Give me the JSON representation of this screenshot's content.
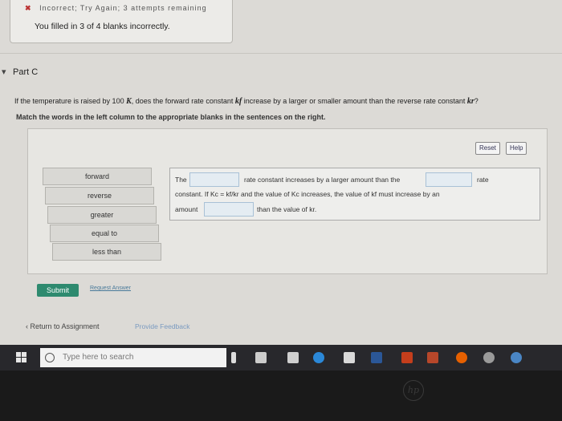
{
  "feedback": {
    "top_line": "Incorrect; Try Again; 3 attempts remaining",
    "message": "You filled in 3 of 4 blanks incorrectly."
  },
  "part": {
    "label": "Part C"
  },
  "question": {
    "prefix": "If the temperature is raised by 100",
    "unit": "K",
    "mid": ", does the forward rate constant",
    "kf": "kf",
    "suffix": "increase by a larger or smaller amount than the reverse rate constant",
    "kr": "kr",
    "qmark": "?"
  },
  "instruction": "Match the words in the left column to the appropriate blanks in the sentences on the right.",
  "panel": {
    "reset_label": "Reset",
    "help_label": "Help",
    "words": [
      "forward",
      "reverse",
      "greater",
      "equal to",
      "less than"
    ],
    "sentence": {
      "s1_a": "The",
      "s1_b": "rate constant increases by a larger amount than the",
      "s1_c": "rate",
      "s2": "constant. If Kc = kf/kr and the value of Kc increases, the value of kf must increase by an",
      "s3_a": "amount",
      "s3_b": "than the value of kr."
    }
  },
  "actions": {
    "submit_label": "Submit",
    "request_label": "Request Answer",
    "return_label": "‹ Return to Assignment",
    "provide_label": "Provide Feedback"
  },
  "taskbar": {
    "search_placeholder": "Type here to search"
  },
  "colors": {
    "submit": "#2e8a6f",
    "blank": "#e4ecf2",
    "taskbar": "#28282c"
  }
}
